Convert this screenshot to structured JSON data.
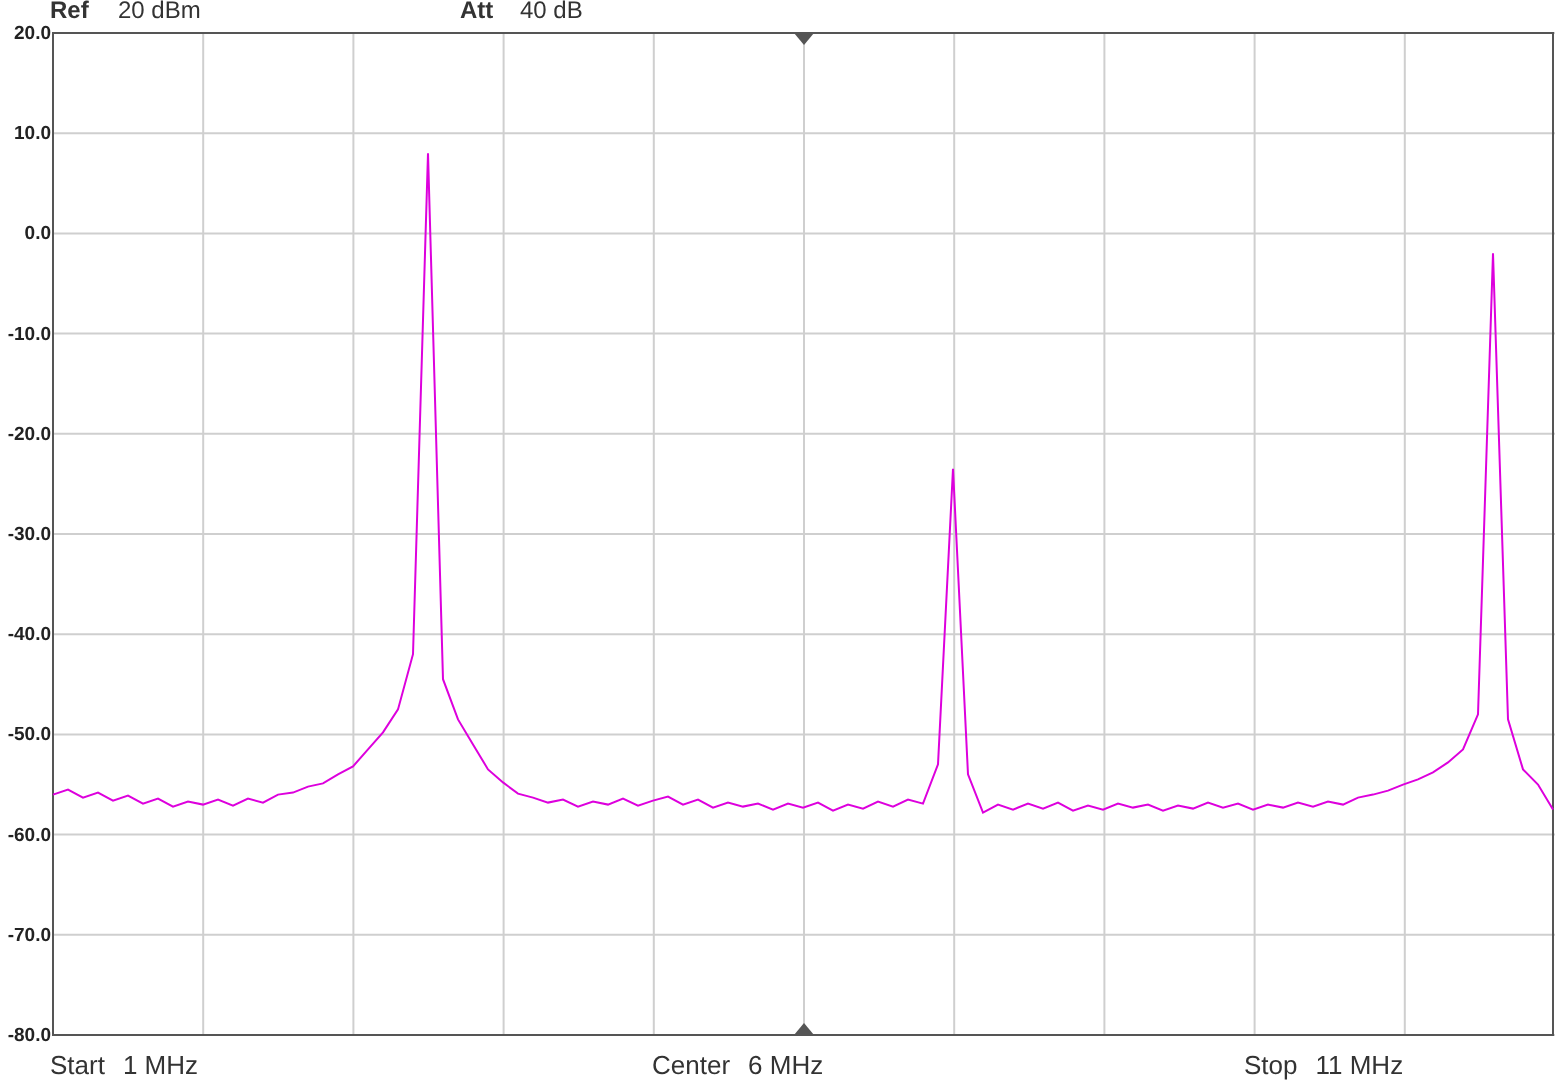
{
  "header": [
    {
      "label": "Ref",
      "value": "20 dBm"
    },
    {
      "label": "Att",
      "value": "40 dB"
    }
  ],
  "chart_data": {
    "type": "line",
    "grid": true,
    "ylim": [
      -80,
      20
    ],
    "yticks": [
      {
        "value": 20,
        "label": "20.0"
      },
      {
        "value": 10,
        "label": "10.0"
      },
      {
        "value": 0,
        "label": "0.0"
      },
      {
        "value": -10,
        "label": "-10.0"
      },
      {
        "value": -20,
        "label": "-20.0"
      },
      {
        "value": -30,
        "label": "-30.0"
      },
      {
        "value": -40,
        "label": "-40.0"
      },
      {
        "value": -50,
        "label": "-50.0"
      },
      {
        "value": -60,
        "label": "-60.0"
      },
      {
        "value": -70,
        "label": "-70.0"
      },
      {
        "value": -80,
        "label": "-80.0"
      }
    ],
    "categories": [
      null,
      null,
      null,
      null,
      null,
      null,
      null,
      null,
      null,
      null,
      null,
      null,
      null,
      null,
      null,
      null,
      null,
      null,
      null,
      null,
      null,
      null,
      null,
      null,
      null,
      null,
      null,
      null,
      null,
      null,
      null,
      null,
      null,
      null,
      null,
      null,
      null,
      null,
      null,
      null,
      null,
      null,
      null,
      null,
      null,
      null,
      null,
      null,
      null,
      null,
      null,
      null,
      null,
      null,
      null,
      null,
      null,
      null,
      null,
      null,
      null,
      null,
      null,
      null,
      null,
      null,
      null,
      null,
      null,
      null,
      null,
      null,
      null,
      null,
      null,
      null,
      null,
      null,
      null,
      null,
      null,
      null,
      null,
      null,
      null,
      null,
      null,
      null,
      null,
      null,
      null,
      null,
      null,
      null,
      null,
      null,
      null,
      null,
      null,
      null,
      null
    ],
    "series": [
      {
        "color": "#dd00dd",
        "values": [
          -56.0,
          -55.5,
          -56.3,
          -55.8,
          -56.6,
          -56.1,
          -56.9,
          -56.4,
          -57.2,
          -56.7,
          -57.0,
          -56.5,
          -57.1,
          -56.4,
          -56.8,
          -56.0,
          -55.8,
          -55.2,
          -54.9,
          -54.0,
          -53.2,
          -51.5,
          -49.8,
          -47.5,
          -42.0,
          8.0,
          -44.5,
          -48.5,
          -51.0,
          -53.5,
          -54.8,
          -55.9,
          -56.3,
          -56.8,
          -56.5,
          -57.2,
          -56.7,
          -57.0,
          -56.4,
          -57.1,
          -56.6,
          -56.2,
          -57.0,
          -56.5,
          -57.3,
          -56.8,
          -57.2,
          -56.9,
          -57.5,
          -56.9,
          -57.3,
          -56.8,
          -57.6,
          -57.0,
          -57.4,
          -56.7,
          -57.2,
          -56.5,
          -56.9,
          -53.0,
          -23.5,
          -54.0,
          -57.8,
          -57.0,
          -57.5,
          -56.9,
          -57.4,
          -56.8,
          -57.6,
          -57.1,
          -57.5,
          -56.9,
          -57.3,
          -57.0,
          -57.6,
          -57.1,
          -57.4,
          -56.8,
          -57.3,
          -56.9,
          -57.5,
          -57.0,
          -57.3,
          -56.8,
          -57.2,
          -56.7,
          -57.0,
          -56.3,
          -56.0,
          -55.6,
          -55.0,
          -54.5,
          -53.8,
          -52.8,
          -51.5,
          -48.0,
          -2.0,
          -48.5,
          -53.5,
          -55.0,
          -57.5
        ]
      }
    ]
  },
  "footer": [
    {
      "label": "Start",
      "value": "1 MHz"
    },
    {
      "label": "Center",
      "value": "6 MHz"
    },
    {
      "label": "Stop",
      "value": "11 MHz"
    }
  ]
}
